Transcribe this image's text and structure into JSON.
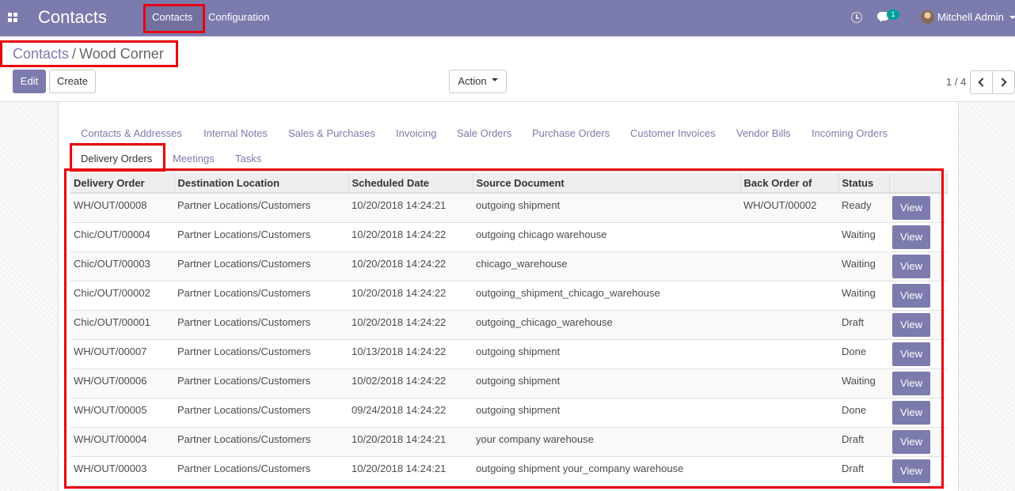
{
  "navbar": {
    "app_title": "Contacts",
    "menu": [
      "Contacts",
      "Configuration"
    ],
    "chat_count": "1",
    "user_name": "Mitchell Admin"
  },
  "breadcrumb": {
    "parent": "Contacts",
    "separator": "/",
    "current": "Wood Corner"
  },
  "buttons": {
    "edit": "Edit",
    "create": "Create",
    "action": "Action"
  },
  "pager": {
    "value": "1 / 4"
  },
  "tabs": [
    "Contacts & Addresses",
    "Internal Notes",
    "Sales & Purchases",
    "Invoicing",
    "Sale Orders",
    "Purchase Orders",
    "Customer Invoices",
    "Vendor Bills",
    "Incoming Orders",
    "Delivery Orders",
    "Meetings",
    "Tasks"
  ],
  "active_tab": "Delivery Orders",
  "table": {
    "columns": [
      "Delivery Order",
      "Destination Location",
      "Scheduled Date",
      "Source Document",
      "Back Order of",
      "Status",
      ""
    ],
    "view_label": "View",
    "rows": [
      [
        "WH/OUT/00008",
        "Partner Locations/Customers",
        "10/20/2018 14:24:21",
        "outgoing shipment",
        "WH/OUT/00002",
        "Ready"
      ],
      [
        "Chic/OUT/00004",
        "Partner Locations/Customers",
        "10/20/2018 14:24:22",
        "outgoing chicago warehouse",
        "",
        "Waiting"
      ],
      [
        "Chic/OUT/00003",
        "Partner Locations/Customers",
        "10/20/2018 14:24:22",
        "chicago_warehouse",
        "",
        "Waiting"
      ],
      [
        "Chic/OUT/00002",
        "Partner Locations/Customers",
        "10/20/2018 14:24:22",
        "outgoing_shipment_chicago_warehouse",
        "",
        "Waiting"
      ],
      [
        "Chic/OUT/00001",
        "Partner Locations/Customers",
        "10/20/2018 14:24:22",
        "outgoing_chicago_warehouse",
        "",
        "Draft"
      ],
      [
        "WH/OUT/00007",
        "Partner Locations/Customers",
        "10/13/2018 14:24:22",
        "outgoing shipment",
        "",
        "Done"
      ],
      [
        "WH/OUT/00006",
        "Partner Locations/Customers",
        "10/02/2018 14:24:22",
        "outgoing shipment",
        "",
        "Waiting"
      ],
      [
        "WH/OUT/00005",
        "Partner Locations/Customers",
        "09/24/2018 14:24:22",
        "outgoing shipment",
        "",
        "Done"
      ],
      [
        "WH/OUT/00004",
        "Partner Locations/Customers",
        "10/20/2018 14:24:21",
        "your company warehouse",
        "",
        "Draft"
      ],
      [
        "WH/OUT/00003",
        "Partner Locations/Customers",
        "10/20/2018 14:24:21",
        "outgoing shipment your_company warehouse",
        "",
        "Draft"
      ]
    ]
  },
  "colors": {
    "brand": "#7c7bad",
    "highlight": "#e8000f"
  }
}
